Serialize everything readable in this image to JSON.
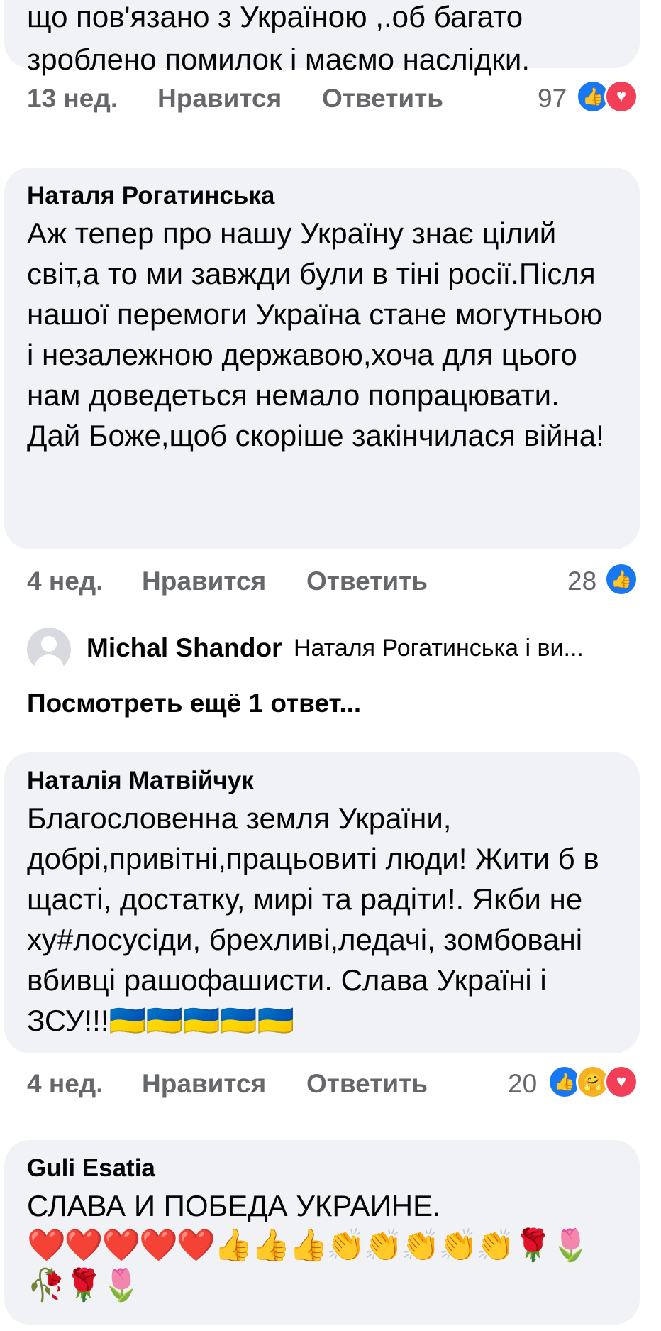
{
  "comments": [
    {
      "text": "що пов'язано з Україною ,.об багато\nзроблено помилок і маємо наслідки.",
      "time": "13 нед.",
      "like_label": "Нравится",
      "reply_label": "Ответить",
      "reaction_count": "97",
      "reactions": [
        "like-icon",
        "love-icon"
      ]
    },
    {
      "author": "Наталя Рогатинська",
      "text": "Аж тепер про нашу Україну знає цілий світ,а то ми завжди були в тіні росії.Після  нашої перемоги Україна стане могутньою і незалежною державою,хоча для цього нам доведеться немало попрацювати. Дай Боже,щоб скоріше закінчилася війна!",
      "time": "4 нед.",
      "like_label": "Нравится",
      "reply_label": "Ответить",
      "reaction_count": "28",
      "reactions": [
        "like-icon"
      ]
    },
    {
      "author": "Наталія Матвійчук",
      "text": "Благословенна земля України, добрі,привітні,працьовиті люди! Жити б в щасті, достатку, мирі та радіти!. Якби не  ху#лосусіди, брехливі,ледачі, зомбовані вбивці рашофашисти. Слава Україні і ЗСУ!!!🇺🇦🇺🇦🇺🇦🇺🇦🇺🇦",
      "time": "4 нед.",
      "like_label": "Нравится",
      "reply_label": "Ответить",
      "reaction_count": "20",
      "reactions": [
        "like-icon",
        "care-icon",
        "love-icon"
      ]
    },
    {
      "author": "Guli Esatia",
      "text": "СЛАВА И ПОБЕДА УКРАИНЕ.",
      "emojis": "❤️❤️❤️❤️❤️👍👍👍👏👏👏👏👏🌹🌷🥀🌹🌷"
    }
  ],
  "reply_preview": {
    "name": "Michal Shandor",
    "text": "Наталя Рогатинська і ви..."
  },
  "more_replies_label": "Посмотреть ещё 1 ответ...",
  "colors": {
    "bubble": "#f0f2f5",
    "meta": "#65676b",
    "like": "#1877f2",
    "love": "#f33e58",
    "care": "#f7b125"
  }
}
